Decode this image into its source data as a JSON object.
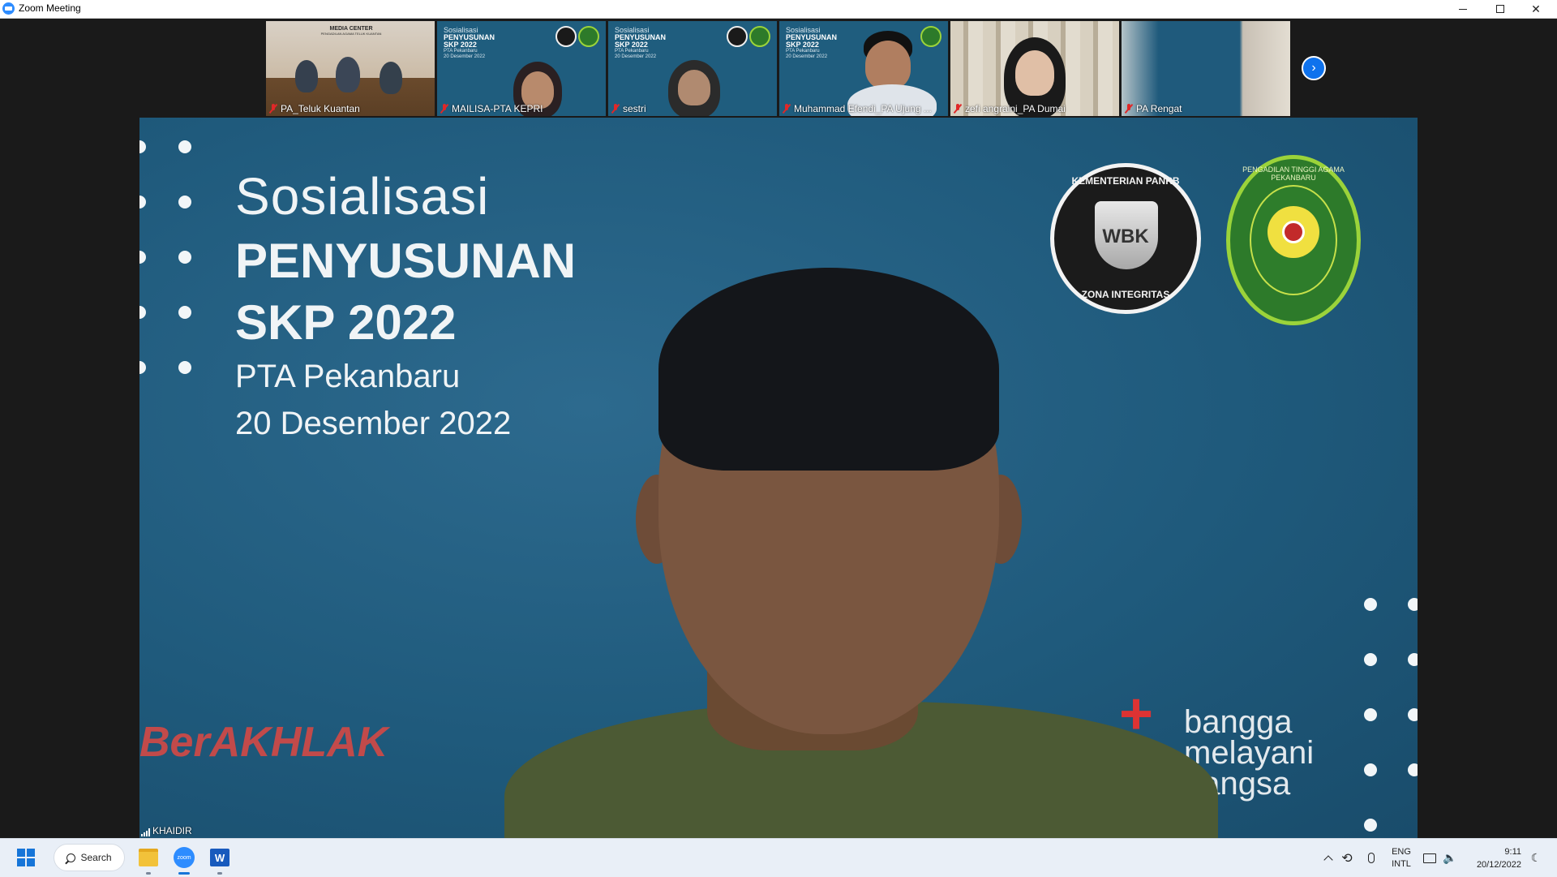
{
  "window": {
    "title": "Zoom Meeting"
  },
  "gallery": {
    "participants": [
      {
        "name": "PA_Teluk Kuantan",
        "muted": true
      },
      {
        "name": "MAILISA-PTA KEPRI",
        "muted": true
      },
      {
        "name": "sestri",
        "muted": true
      },
      {
        "name": "Muhammad Efendi_PA Ujung ...",
        "muted": true
      },
      {
        "name": "zefi angraini_PA Dumai",
        "muted": true
      },
      {
        "name": "PA Rengat",
        "muted": true
      }
    ],
    "tile1_banner": {
      "line1": "MEDIA CENTER",
      "line2": "PENGADILAN AGAMA TELUK KUANTAN"
    },
    "mini_slide": {
      "line1": "Sosialisasi",
      "line2": "PENYUSUNAN",
      "line3": "SKP 2022",
      "line4": "PTA Pekanbaru",
      "line5": "20 Desember 2022"
    }
  },
  "slide": {
    "title": "Sosialisasi",
    "heading_line1": "PENYUSUNAN",
    "heading_line2": "SKP 2022",
    "org": "PTA Pekanbaru",
    "date": "20 Desember 2022",
    "logo_wbk": {
      "top": "KEMENTERIAN PANRB",
      "center": "WBK",
      "bottom": "ZONA INTEGRITAS"
    },
    "logo_pta": {
      "ring": "PENGADILAN TINGGI AGAMA PEKANBARU"
    },
    "footer_left": "BerAKHLAK",
    "footer_right": {
      "line1": "bangga",
      "line2": "melayani",
      "line3": "bangsa"
    }
  },
  "speaker": {
    "name": "KHAIDIR"
  },
  "taskbar": {
    "search_label": "Search",
    "zoom_label": "zoom",
    "word_label": "W",
    "lang_line1": "ENG",
    "lang_line2": "INTL",
    "time": "9:11",
    "date": "20/12/2022"
  },
  "colors": {
    "slide_bg": "#1f5a7c",
    "zoom_blue": "#2d8cff",
    "muted_red": "#e02828",
    "taskbar_bg": "#e9eff7"
  },
  "icons": [
    "zoom-app-icon",
    "minimize-icon",
    "maximize-icon",
    "close-icon",
    "mic-off-icon",
    "next-page-icon",
    "signal-icon",
    "start-icon",
    "search-icon",
    "file-explorer-icon",
    "zoom-icon",
    "word-icon",
    "chevron-up-icon",
    "sync-icon",
    "microphone-icon",
    "network-icon",
    "volume-icon",
    "moon-icon"
  ]
}
